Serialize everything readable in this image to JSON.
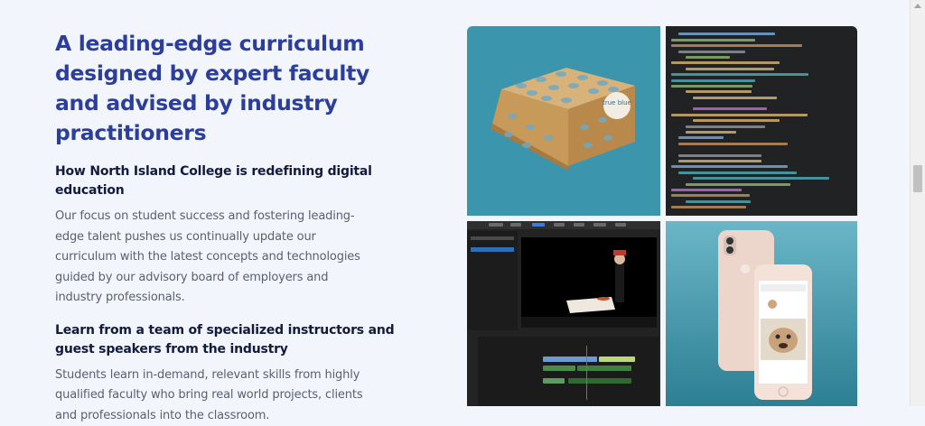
{
  "content": {
    "headline": "A leading-edge curriculum designed by expert faculty and advised by industry practitioners",
    "section1": {
      "heading": "How North Island College is redefining digital education",
      "body": "Our focus on student success and fostering leading-edge talent pushes us continually update our curriculum with the latest concepts and technologies guided by our advisory board of employers and industry professionals."
    },
    "section2": {
      "heading": "Learn from a team of specialized instructors and guest speakers from the industry",
      "body": "Students learn in-demand, relevant skills from highly qualified faculty who bring real world projects, clients and professionals into the classroom."
    }
  },
  "gallery": {
    "box_brand": "true blue",
    "colors": {
      "teal": "#3b96ad",
      "code_bg": "#202224",
      "video_bg": "#232323",
      "phone_bg": "#3a8fa4"
    }
  }
}
